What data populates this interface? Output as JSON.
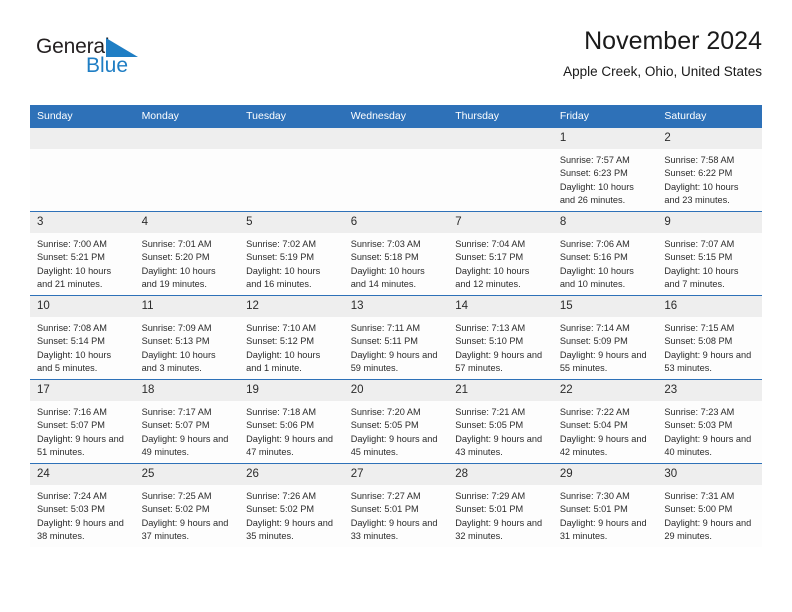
{
  "brand": {
    "name_part1": "General",
    "name_part2": "Blue",
    "triangle_icon": "triangle-logo-icon",
    "accent_color": "#1f7ec4"
  },
  "header": {
    "title": "November 2024",
    "location": "Apple Creek, Ohio, United States"
  },
  "theme": {
    "header_blue": "#2e71b8",
    "date_band_gray": "#eeeeee",
    "cell_background": "#fdfdfd"
  },
  "weekdays": [
    "Sunday",
    "Monday",
    "Tuesday",
    "Wednesday",
    "Thursday",
    "Friday",
    "Saturday"
  ],
  "labels": {
    "sunrise_prefix": "Sunrise:",
    "sunset_prefix": "Sunset:",
    "daylight_prefix": "Daylight:"
  },
  "weeks": [
    [
      {
        "day": "",
        "empty": true
      },
      {
        "day": "",
        "empty": true
      },
      {
        "day": "",
        "empty": true
      },
      {
        "day": "",
        "empty": true
      },
      {
        "day": "",
        "empty": true
      },
      {
        "day": "1",
        "sunrise": "Sunrise: 7:57 AM",
        "sunset": "Sunset: 6:23 PM",
        "daylight": "Daylight: 10 hours and 26 minutes."
      },
      {
        "day": "2",
        "sunrise": "Sunrise: 7:58 AM",
        "sunset": "Sunset: 6:22 PM",
        "daylight": "Daylight: 10 hours and 23 minutes."
      }
    ],
    [
      {
        "day": "3",
        "sunrise": "Sunrise: 7:00 AM",
        "sunset": "Sunset: 5:21 PM",
        "daylight": "Daylight: 10 hours and 21 minutes."
      },
      {
        "day": "4",
        "sunrise": "Sunrise: 7:01 AM",
        "sunset": "Sunset: 5:20 PM",
        "daylight": "Daylight: 10 hours and 19 minutes."
      },
      {
        "day": "5",
        "sunrise": "Sunrise: 7:02 AM",
        "sunset": "Sunset: 5:19 PM",
        "daylight": "Daylight: 10 hours and 16 minutes."
      },
      {
        "day": "6",
        "sunrise": "Sunrise: 7:03 AM",
        "sunset": "Sunset: 5:18 PM",
        "daylight": "Daylight: 10 hours and 14 minutes."
      },
      {
        "day": "7",
        "sunrise": "Sunrise: 7:04 AM",
        "sunset": "Sunset: 5:17 PM",
        "daylight": "Daylight: 10 hours and 12 minutes."
      },
      {
        "day": "8",
        "sunrise": "Sunrise: 7:06 AM",
        "sunset": "Sunset: 5:16 PM",
        "daylight": "Daylight: 10 hours and 10 minutes."
      },
      {
        "day": "9",
        "sunrise": "Sunrise: 7:07 AM",
        "sunset": "Sunset: 5:15 PM",
        "daylight": "Daylight: 10 hours and 7 minutes."
      }
    ],
    [
      {
        "day": "10",
        "sunrise": "Sunrise: 7:08 AM",
        "sunset": "Sunset: 5:14 PM",
        "daylight": "Daylight: 10 hours and 5 minutes."
      },
      {
        "day": "11",
        "sunrise": "Sunrise: 7:09 AM",
        "sunset": "Sunset: 5:13 PM",
        "daylight": "Daylight: 10 hours and 3 minutes."
      },
      {
        "day": "12",
        "sunrise": "Sunrise: 7:10 AM",
        "sunset": "Sunset: 5:12 PM",
        "daylight": "Daylight: 10 hours and 1 minute."
      },
      {
        "day": "13",
        "sunrise": "Sunrise: 7:11 AM",
        "sunset": "Sunset: 5:11 PM",
        "daylight": "Daylight: 9 hours and 59 minutes."
      },
      {
        "day": "14",
        "sunrise": "Sunrise: 7:13 AM",
        "sunset": "Sunset: 5:10 PM",
        "daylight": "Daylight: 9 hours and 57 minutes."
      },
      {
        "day": "15",
        "sunrise": "Sunrise: 7:14 AM",
        "sunset": "Sunset: 5:09 PM",
        "daylight": "Daylight: 9 hours and 55 minutes."
      },
      {
        "day": "16",
        "sunrise": "Sunrise: 7:15 AM",
        "sunset": "Sunset: 5:08 PM",
        "daylight": "Daylight: 9 hours and 53 minutes."
      }
    ],
    [
      {
        "day": "17",
        "sunrise": "Sunrise: 7:16 AM",
        "sunset": "Sunset: 5:07 PM",
        "daylight": "Daylight: 9 hours and 51 minutes."
      },
      {
        "day": "18",
        "sunrise": "Sunrise: 7:17 AM",
        "sunset": "Sunset: 5:07 PM",
        "daylight": "Daylight: 9 hours and 49 minutes."
      },
      {
        "day": "19",
        "sunrise": "Sunrise: 7:18 AM",
        "sunset": "Sunset: 5:06 PM",
        "daylight": "Daylight: 9 hours and 47 minutes."
      },
      {
        "day": "20",
        "sunrise": "Sunrise: 7:20 AM",
        "sunset": "Sunset: 5:05 PM",
        "daylight": "Daylight: 9 hours and 45 minutes."
      },
      {
        "day": "21",
        "sunrise": "Sunrise: 7:21 AM",
        "sunset": "Sunset: 5:05 PM",
        "daylight": "Daylight: 9 hours and 43 minutes."
      },
      {
        "day": "22",
        "sunrise": "Sunrise: 7:22 AM",
        "sunset": "Sunset: 5:04 PM",
        "daylight": "Daylight: 9 hours and 42 minutes."
      },
      {
        "day": "23",
        "sunrise": "Sunrise: 7:23 AM",
        "sunset": "Sunset: 5:03 PM",
        "daylight": "Daylight: 9 hours and 40 minutes."
      }
    ],
    [
      {
        "day": "24",
        "sunrise": "Sunrise: 7:24 AM",
        "sunset": "Sunset: 5:03 PM",
        "daylight": "Daylight: 9 hours and 38 minutes."
      },
      {
        "day": "25",
        "sunrise": "Sunrise: 7:25 AM",
        "sunset": "Sunset: 5:02 PM",
        "daylight": "Daylight: 9 hours and 37 minutes."
      },
      {
        "day": "26",
        "sunrise": "Sunrise: 7:26 AM",
        "sunset": "Sunset: 5:02 PM",
        "daylight": "Daylight: 9 hours and 35 minutes."
      },
      {
        "day": "27",
        "sunrise": "Sunrise: 7:27 AM",
        "sunset": "Sunset: 5:01 PM",
        "daylight": "Daylight: 9 hours and 33 minutes."
      },
      {
        "day": "28",
        "sunrise": "Sunrise: 7:29 AM",
        "sunset": "Sunset: 5:01 PM",
        "daylight": "Daylight: 9 hours and 32 minutes."
      },
      {
        "day": "29",
        "sunrise": "Sunrise: 7:30 AM",
        "sunset": "Sunset: 5:01 PM",
        "daylight": "Daylight: 9 hours and 31 minutes."
      },
      {
        "day": "30",
        "sunrise": "Sunrise: 7:31 AM",
        "sunset": "Sunset: 5:00 PM",
        "daylight": "Daylight: 9 hours and 29 minutes."
      }
    ]
  ]
}
